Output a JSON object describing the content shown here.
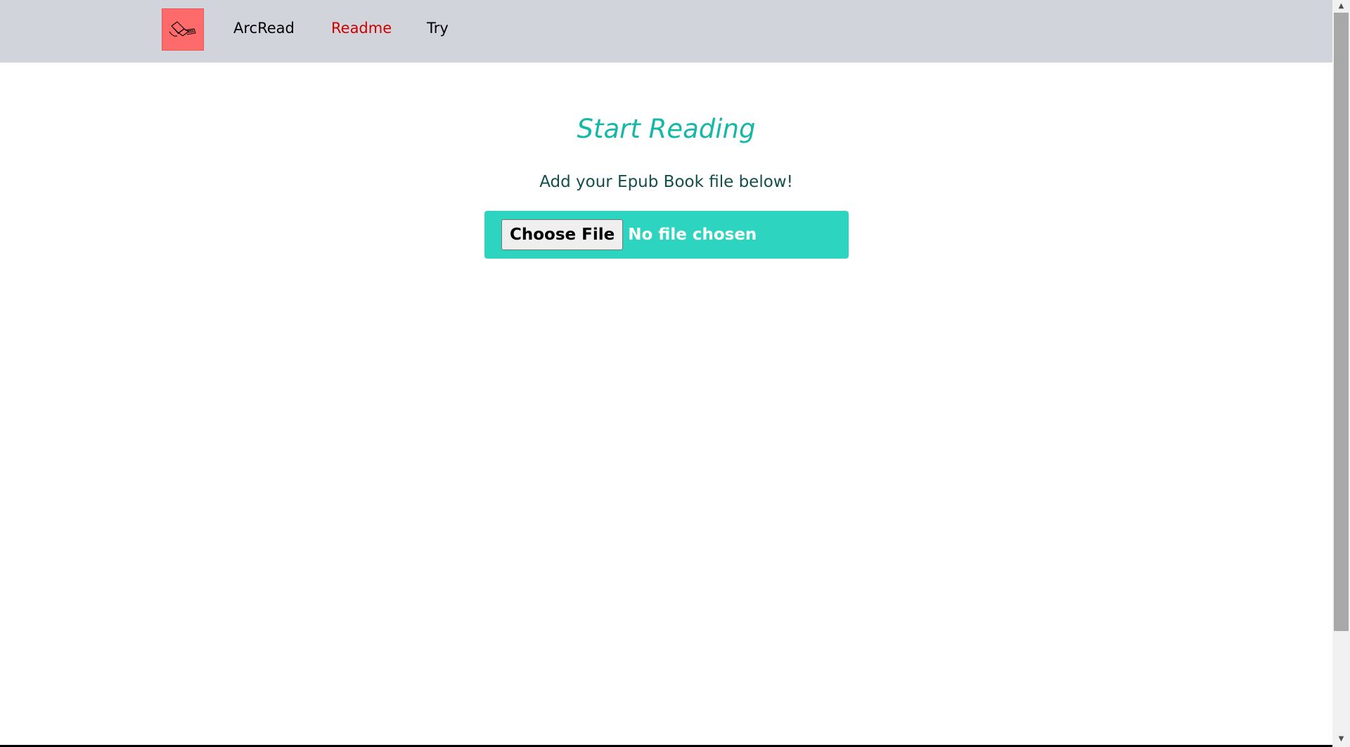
{
  "nav": {
    "brand": "ArcRead",
    "readme": "Readme",
    "try": "Try",
    "logo_icon": "book-reading-icon"
  },
  "main": {
    "title": "Start Reading",
    "subtitle": "Add your Epub Book file below!",
    "file_input": {
      "button_label": "Choose File",
      "status": "No file chosen"
    }
  },
  "colors": {
    "navbar_bg": "#d1d5db",
    "logo_bg": "#ff6b6b",
    "active_link": "#cc0000",
    "title": "#14b8a6",
    "subtitle": "#134e4a",
    "file_box": "#2dd4bf"
  }
}
